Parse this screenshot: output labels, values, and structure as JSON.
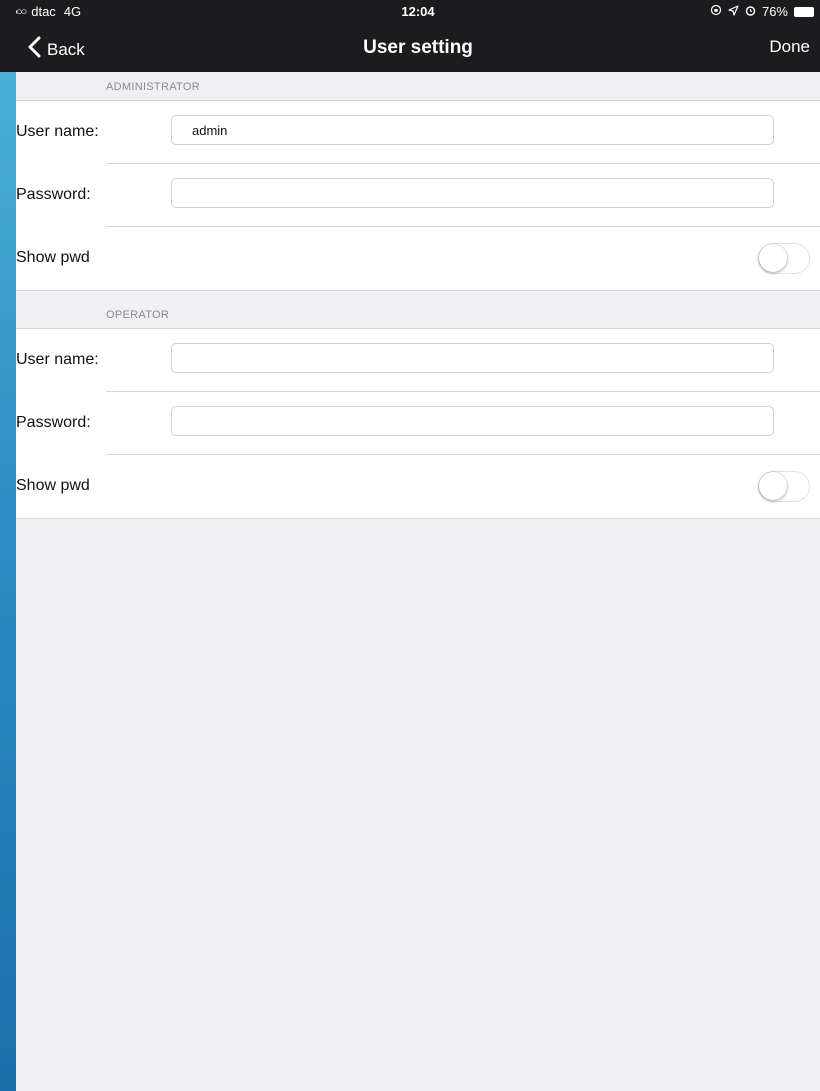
{
  "status_bar": {
    "signal": "●●●○○",
    "carrier": "dtac",
    "network": "4G",
    "time": "12:04",
    "icons": [
      "lock-rotation-icon",
      "location-arrow-icon",
      "alarm-icon"
    ],
    "battery": "76%"
  },
  "nav": {
    "back_label": "Back",
    "title": "User setting",
    "done_label": "Done"
  },
  "sections": [
    {
      "header": "ADMINISTRATOR",
      "user_label": "User name:",
      "user_value": "admin",
      "password_label": "Password:",
      "password_value": "",
      "show_pwd_label": "Show pwd",
      "show_pwd_on": false
    },
    {
      "header": "OPERATOR",
      "user_label": "User name:",
      "user_value": "",
      "password_label": "Password:",
      "password_value": "",
      "show_pwd_label": "Show pwd",
      "show_pwd_on": false
    }
  ],
  "colors": {
    "bar": "#1c1c1e",
    "background": "#efeff4",
    "section_text": "#8a8a8f",
    "separator": "#d6d6da"
  }
}
